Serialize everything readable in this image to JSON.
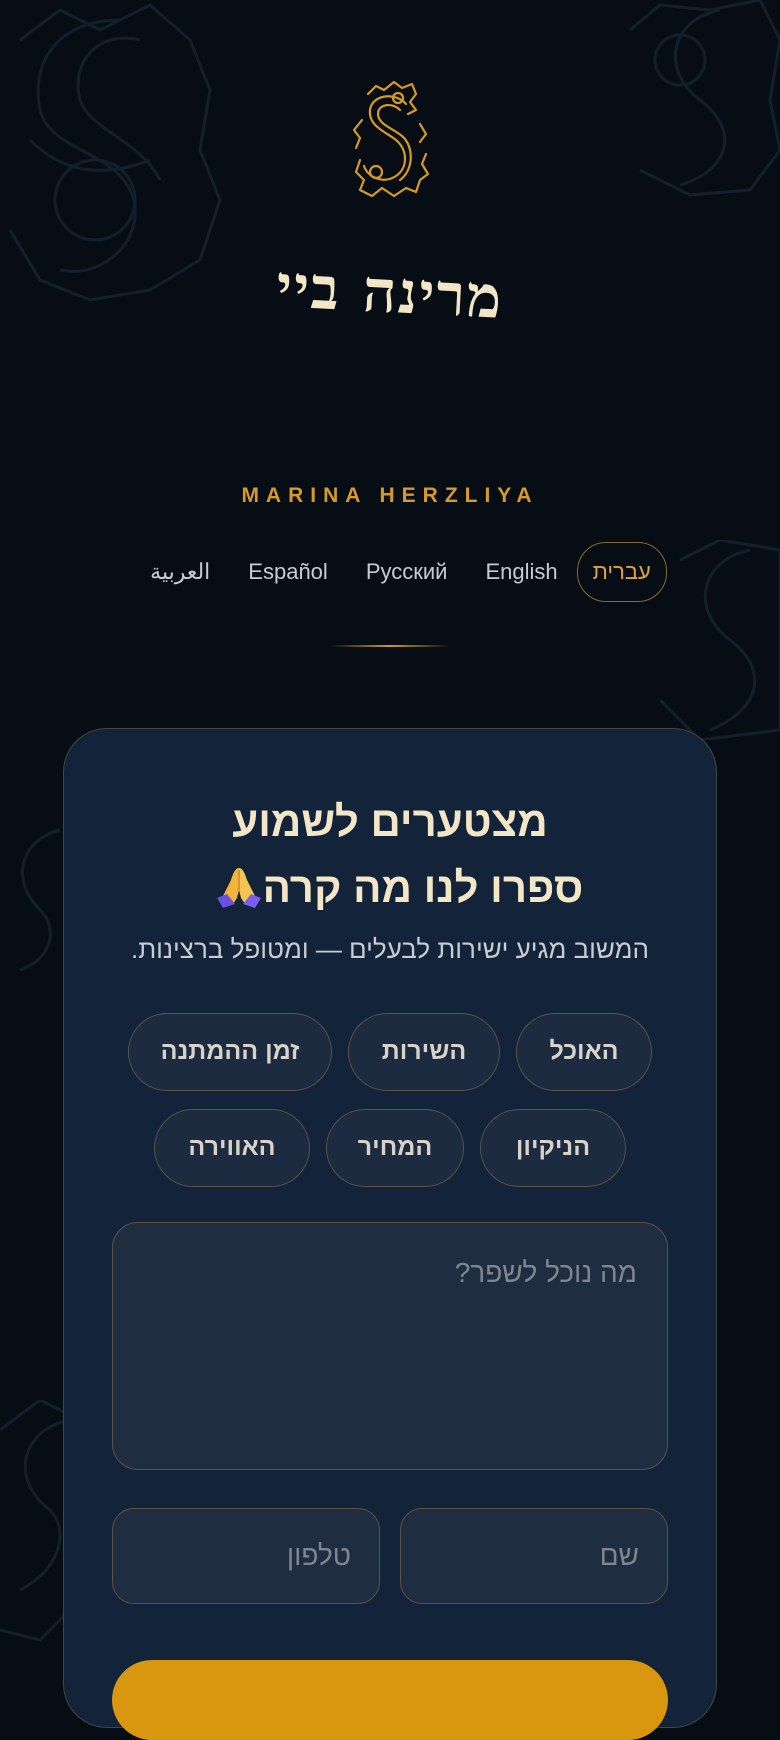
{
  "brand": {
    "name": "מרינה ביי",
    "subtitle": "MARINA HERZLIYA",
    "accent_color": "#d89a24",
    "logo_icon": "ornate-letter-s-logo"
  },
  "languages": [
    {
      "label": "עברית",
      "active": true
    },
    {
      "label": "English",
      "active": false
    },
    {
      "label": "Русский",
      "active": false
    },
    {
      "label": "Español",
      "active": false
    },
    {
      "label": "العربية",
      "active": false
    }
  ],
  "feedback": {
    "title_line1": "מצטערים לשמוע",
    "title_line2": "ספרו לנו מה קרה",
    "title_icon": "folded-hands-emoji",
    "subtitle": "המשוב מגיע ישירות לבעלים — ומטופל ברצינות.",
    "categories": [
      "האוכל",
      "השירות",
      "זמן ההמתנה",
      "הניקיון",
      "המחיר",
      "האווירה"
    ],
    "textarea_placeholder": "מה נוכל לשפר?",
    "name_placeholder": "שם",
    "phone_placeholder": "טלפון"
  }
}
